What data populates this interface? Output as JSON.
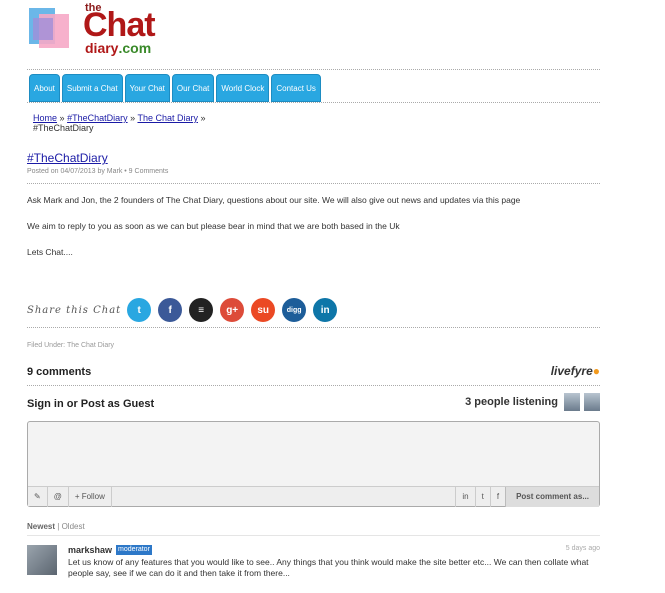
{
  "logo": {
    "the": "the",
    "chat": "Chat",
    "diary": "diary",
    "dotcom": ".com"
  },
  "nav": [
    "About",
    "Submit a Chat",
    "Your Chat",
    "Our Chat",
    "World Clock",
    "Contact Us"
  ],
  "breadcrumb": {
    "home": "Home",
    "sep": "»",
    "tag": "#TheChatDiary",
    "section": "The Chat Diary",
    "current": "#TheChatDiary"
  },
  "post": {
    "title": "#TheChatDiary",
    "meta": "Posted on 04/07/2013 by Mark • 9 Comments",
    "paragraphs": [
      "Ask Mark and Jon, the 2 founders of The Chat Diary, questions about our site. We will also give out news and updates via this page",
      "We aim to reply to you as soon as we can but please bear in mind that we are both based in the Uk",
      "Lets Chat...."
    ]
  },
  "share": {
    "label": "Share this Chat",
    "icons": [
      {
        "name": "twitter-icon",
        "glyph": "t",
        "color": "#29a7e1"
      },
      {
        "name": "facebook-icon",
        "glyph": "f",
        "color": "#3b5998"
      },
      {
        "name": "buffer-icon",
        "glyph": "≡",
        "color": "#222222"
      },
      {
        "name": "google-plus-icon",
        "glyph": "g+",
        "color": "#dd4b39"
      },
      {
        "name": "stumbleupon-icon",
        "glyph": "su",
        "color": "#eb4924"
      },
      {
        "name": "digg-icon",
        "glyph": "digg",
        "color": "#1d5d99"
      },
      {
        "name": "linkedin-icon",
        "glyph": "in",
        "color": "#0e76a8"
      }
    ]
  },
  "filed": {
    "label": "Filed Under:",
    "category": "The Chat Diary"
  },
  "comments": {
    "count": "9 comments",
    "brand": "livefyre",
    "signin": "Sign in or Post as Guest",
    "listening": "3 people listening",
    "toolbar": {
      "follow": "+ Follow",
      "post": "Post comment as..."
    },
    "sort": {
      "newest": "Newest",
      "sep": "|",
      "oldest": "Oldest"
    },
    "items": [
      {
        "author": "markshaw",
        "badge": "moderator",
        "date": "5 days ago",
        "text": "Let us know of any features that you would like to see.. Any things that you think would make the site better etc... We can then collate what people say, see if we can do it and then take it from there..."
      }
    ]
  }
}
